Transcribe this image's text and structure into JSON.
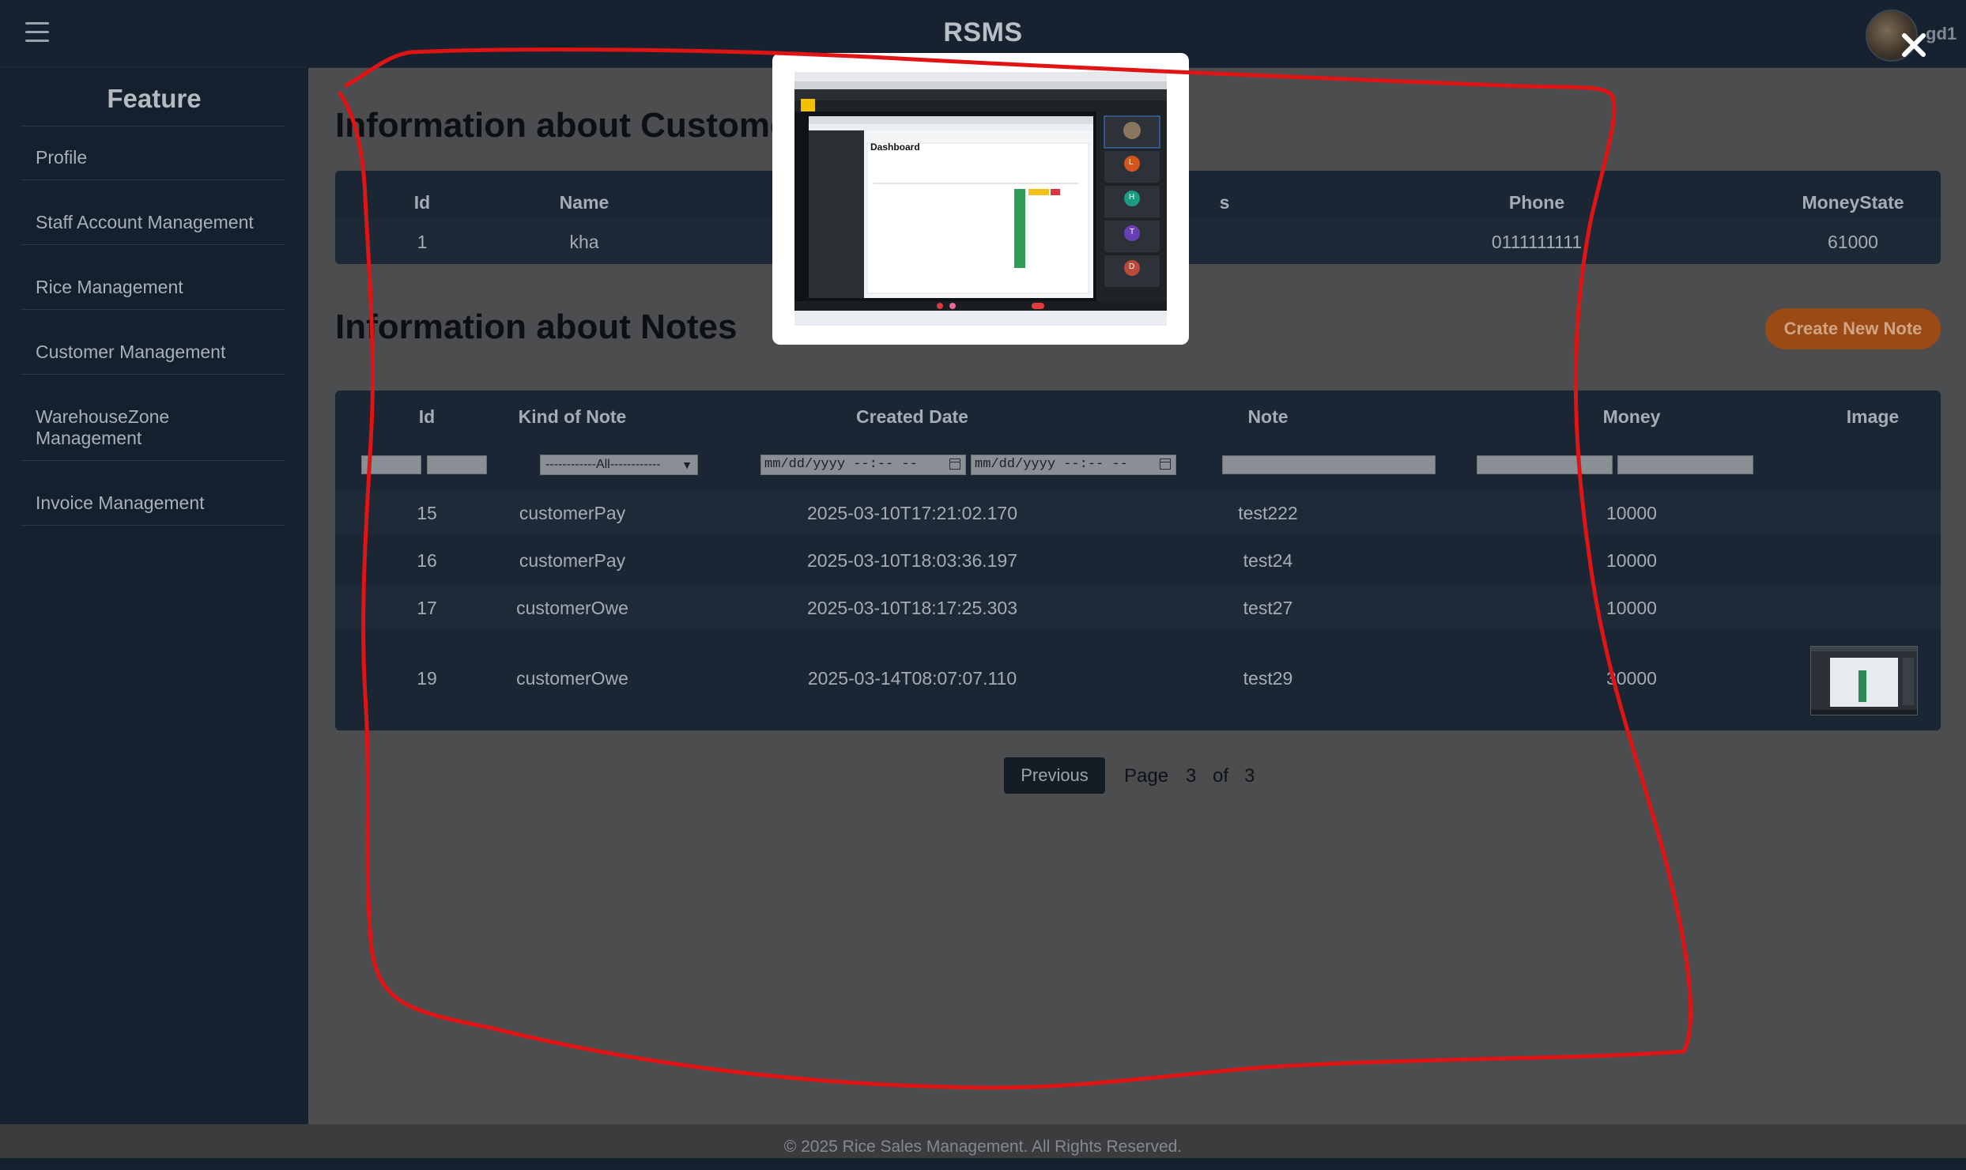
{
  "header": {
    "menu_icon": "hamburger-icon",
    "title": "RSMS",
    "username": "gd1",
    "close_icon": "close-icon"
  },
  "sidebar": {
    "heading": "Feature",
    "items": [
      {
        "label": "Profile"
      },
      {
        "label": "Staff Account Management"
      },
      {
        "label": "Rice Management"
      },
      {
        "label": "Customer Management"
      },
      {
        "label": "WarehouseZone\nManagement"
      },
      {
        "label": "Invoice Management"
      }
    ]
  },
  "customer": {
    "title": "Information about Customer",
    "columns": [
      "Id",
      "Name",
      "Phone",
      "MoneyState"
    ],
    "hidden_column_fragment": "s",
    "row": {
      "id": "1",
      "name": "kha",
      "phone": "0111111111",
      "money_state": "61000"
    }
  },
  "notes": {
    "title": "Information about Notes",
    "create_button": "Create New Note",
    "columns": [
      "Id",
      "Kind of Note",
      "Created Date",
      "Note",
      "Money",
      "Image"
    ],
    "filters": {
      "kind_select": "------------All------------",
      "date_from": "mm/dd/yyyy --:-- --",
      "date_to": "mm/dd/yyyy --:-- --"
    },
    "rows": [
      {
        "id": "15",
        "kind": "customerPay",
        "created": "2025-03-10T17:21:02.170",
        "note": "test222",
        "money": "10000"
      },
      {
        "id": "16",
        "kind": "customerPay",
        "created": "2025-03-10T18:03:36.197",
        "note": "test24",
        "money": "10000"
      },
      {
        "id": "17",
        "kind": "customerOwe",
        "created": "2025-03-10T18:17:25.303",
        "note": "test27",
        "money": "10000"
      },
      {
        "id": "19",
        "kind": "customerOwe",
        "created": "2025-03-14T08:07:07.110",
        "note": "test29",
        "money": "30000"
      }
    ]
  },
  "pagination": {
    "previous": "Previous",
    "page_label": "Page",
    "current": "3",
    "of_label": "of",
    "total": "3"
  },
  "modal": {
    "screenshot_heading": "Dashboard",
    "participant_initials": [
      "L",
      "H",
      "T",
      "D"
    ]
  },
  "footer": {
    "text": "© 2025 Rice Sales Management. All Rights Reserved."
  },
  "colors": {
    "header_bg": "#172230",
    "main_bg": "#4c4d4e",
    "panel_bg": "#1a2633",
    "accent_button": "#9a4a14",
    "annotation_stroke": "#e01414"
  }
}
